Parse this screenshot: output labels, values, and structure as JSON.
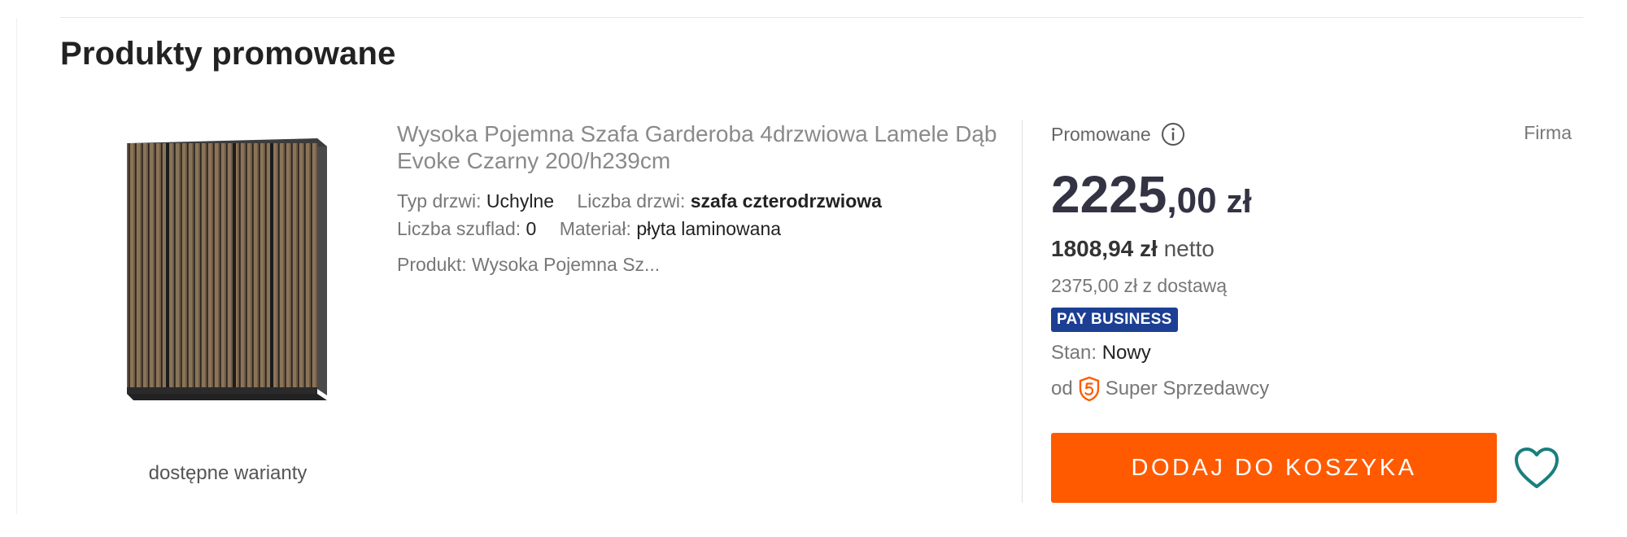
{
  "section": {
    "title": "Produkty promowane"
  },
  "product": {
    "image_alt": "wardrobe-image",
    "variants_link": "dostępne warianty",
    "title": "Wysoka Pojemna Szafa Garderoba 4drzwiowa Lamele Dąb Evoke Czarny 200/h239cm",
    "params": [
      {
        "label": "Typ drzwi:",
        "value": "Uchylne"
      },
      {
        "label": "Liczba drzwi:",
        "value": "szafa czterodrzwiowa"
      },
      {
        "label": "Liczba szuflad:",
        "value": "0"
      },
      {
        "label": "Materiał:",
        "value": "płyta laminowana"
      }
    ],
    "product_line": "Produkt: Wysoka Pojemna Sz..."
  },
  "offer": {
    "promo_label": "Promowane",
    "info_icon": "info-icon",
    "seller_type": "Firma",
    "price_integer": "2225",
    "price_decimal": ",00",
    "currency": "zł",
    "net_price": "1808,94 zł",
    "net_label": "netto",
    "delivery": "2375,00 zł z dostawą",
    "pay_badge": "PAY BUSINESS",
    "condition_label": "Stan:",
    "condition_value": "Nowy",
    "seller_prefix": "od",
    "seller_name": "Super Sprzedawcy",
    "cart_button": "DODAJ DO KOSZYKA",
    "wishlist_icon": "heart-icon"
  },
  "colors": {
    "accent_orange": "#ff5a00",
    "pay_badge_blue": "#1c3f94",
    "heart_teal": "#1a7f7c",
    "price_text": "#334"
  }
}
